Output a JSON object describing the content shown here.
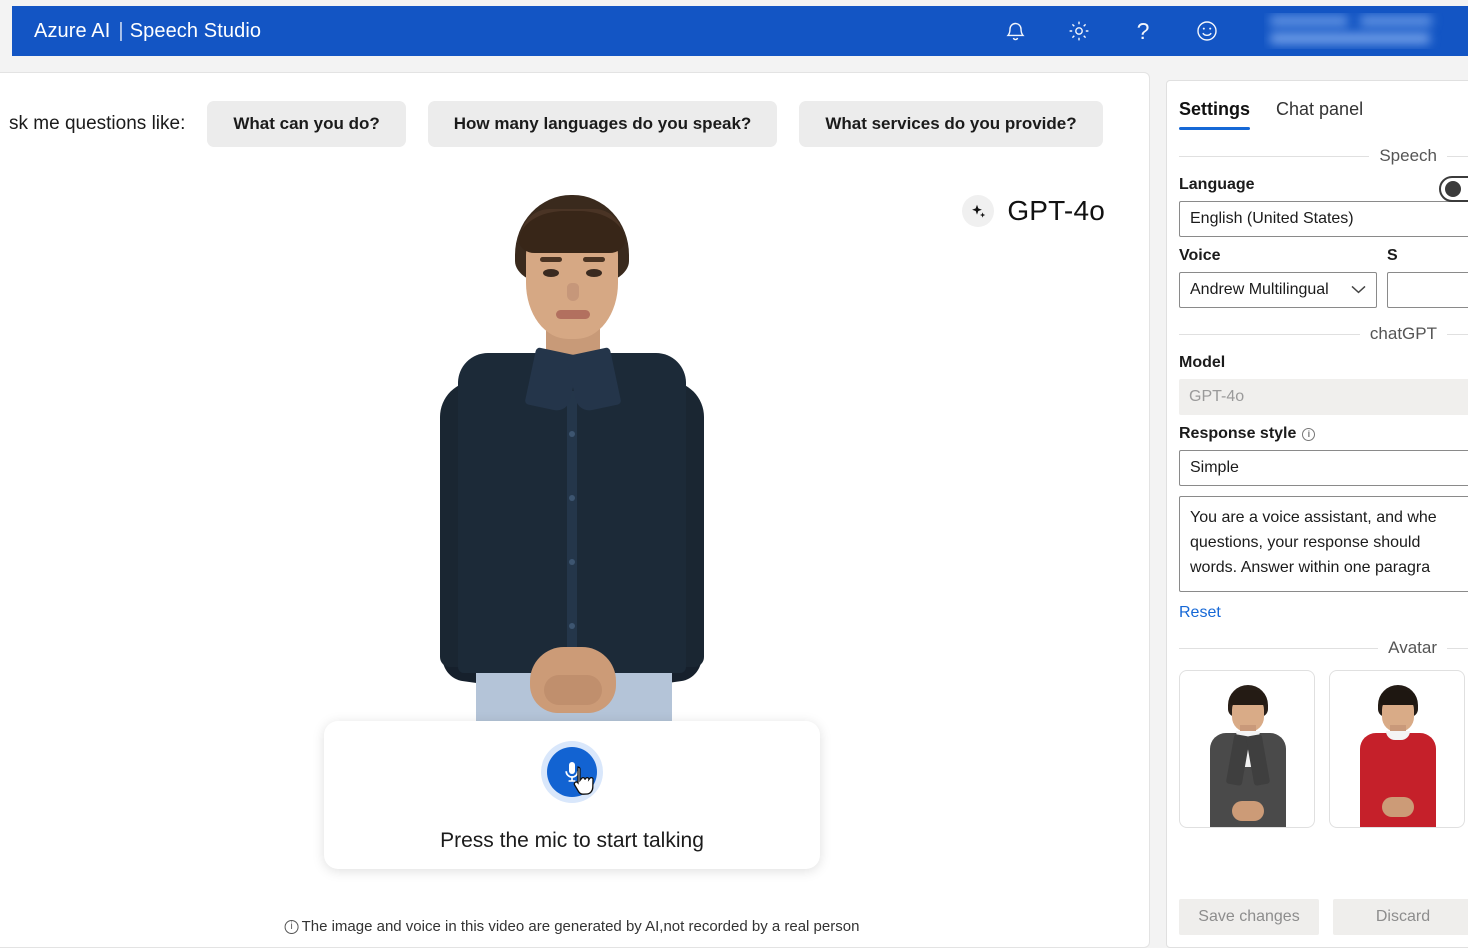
{
  "topbar": {
    "brand_primary": "Azure AI",
    "brand_separator": "|",
    "brand_secondary": "Speech Studio",
    "icons": {
      "notification": "bell-icon",
      "settings": "gear-icon",
      "help": "?",
      "feedback": "smiley-icon"
    }
  },
  "main": {
    "suggest_label": "sk me questions like:",
    "chips": [
      "What can you do?",
      "How many languages do you speak?",
      "What services do you provide?"
    ],
    "model_badge": {
      "icon": "sparkle-icon",
      "label": "GPT-4o"
    },
    "mic_card": {
      "icon": "microphone-icon",
      "text": "Press the mic to start talking"
    },
    "disclaimer": {
      "icon": "info-icon",
      "text": "The image and voice in this video are generated by AI,not recorded by a real person"
    }
  },
  "settings": {
    "tabs": [
      {
        "label": "Settings",
        "active": true
      },
      {
        "label": "Chat panel",
        "active": false
      }
    ],
    "sections": {
      "speech": {
        "title": "Speech",
        "language_label": "Language",
        "language_value": "English (United States)",
        "toggle_state": "off",
        "voice_label": "Voice",
        "voice_value": "Andrew Multilingual",
        "style_label": "S"
      },
      "chatgpt": {
        "title": "chatGPT",
        "model_label": "Model",
        "model_value": "GPT-4o",
        "response_style_label": "Response style",
        "response_style_info": "i",
        "response_style_value": "Simple",
        "prompt_value": "You are a voice assistant, and whe\nquestions, your response should \nwords. Answer within one paragra",
        "reset_label": "Reset"
      },
      "avatar": {
        "title": "Avatar",
        "options": [
          {
            "name": "avatar-option-1",
            "outfit_color": "#4a4a4a",
            "hair_color": "#2a2019"
          },
          {
            "name": "avatar-option-2",
            "outfit_color": "#c5202a",
            "hair_color": "#241c16"
          }
        ]
      }
    },
    "footer": {
      "save_label": "Save changes",
      "discard_label": "Discard"
    }
  },
  "colors": {
    "header_blue": "#1355c4",
    "accent_blue": "#1668d6",
    "chip_gray": "#ececec",
    "mic_blue": "#1263d2"
  }
}
